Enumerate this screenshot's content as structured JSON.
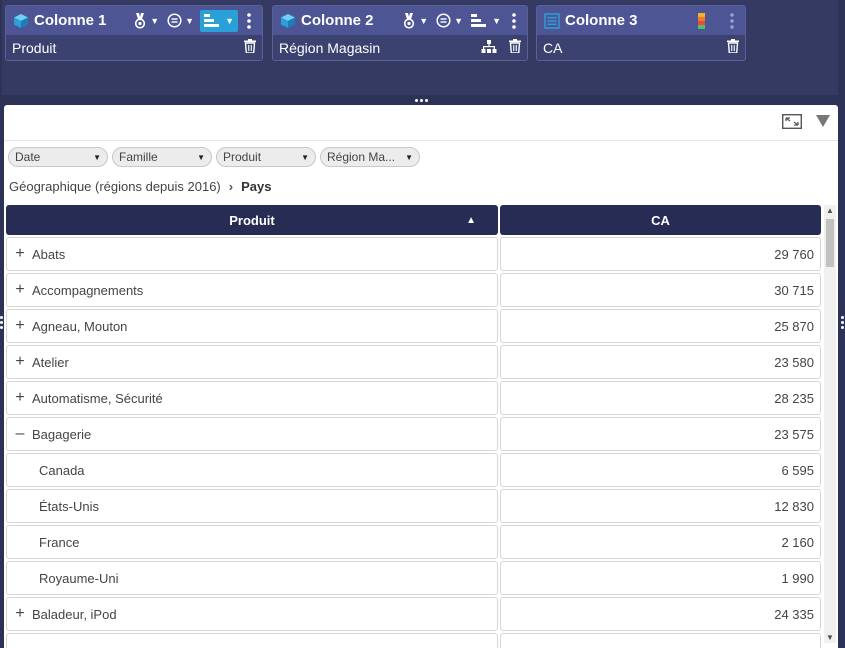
{
  "columns": [
    {
      "title": "Colonne 1",
      "field": "Produit",
      "icon": "cube-icon"
    },
    {
      "title": "Colonne 2",
      "field": "Région Magasin",
      "icon": "cube-icon"
    },
    {
      "title": "Colonne 3",
      "field": "CA",
      "icon": "measure-icon"
    }
  ],
  "filters": [
    {
      "label": "Date"
    },
    {
      "label": "Famille"
    },
    {
      "label": "Produit"
    },
    {
      "label": "Région Ma..."
    }
  ],
  "breadcrumb": {
    "root": "Géographique (régions depuis 2016)",
    "current": "Pays"
  },
  "table": {
    "headers": {
      "col1": "Produit",
      "col2": "CA"
    },
    "rows": [
      {
        "toggle": "+",
        "label": "Abats",
        "value": "29 760"
      },
      {
        "toggle": "+",
        "label": "Accompagnements",
        "value": "30 715"
      },
      {
        "toggle": "+",
        "label": "Agneau, Mouton",
        "value": "25 870"
      },
      {
        "toggle": "+",
        "label": "Atelier",
        "value": "23 580"
      },
      {
        "toggle": "+",
        "label": "Automatisme, Sécurité",
        "value": "28 235"
      },
      {
        "toggle": "–",
        "label": "Bagagerie",
        "value": "23 575"
      },
      {
        "label": "Canada",
        "value": "6 595"
      },
      {
        "label": "États-Unis",
        "value": "12 830"
      },
      {
        "label": "France",
        "value": "2 160"
      },
      {
        "label": "Royaume-Uni",
        "value": "1 990"
      },
      {
        "toggle": "+",
        "label": "Baladeur, iPod",
        "value": "24 335"
      }
    ]
  },
  "colors": {
    "header_bg": "#262c54",
    "accent": "#2aa0d8",
    "panel_bg": "#2d3257",
    "card_head": "#4e5595"
  }
}
